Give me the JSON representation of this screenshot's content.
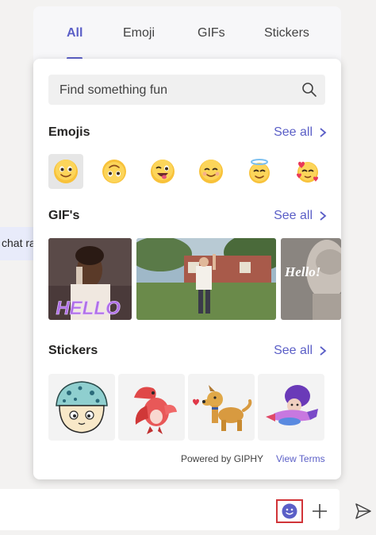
{
  "chat": {
    "snippet": "chat ra"
  },
  "tabs": [
    {
      "label": "All",
      "active": true
    },
    {
      "label": "Emoji",
      "active": false
    },
    {
      "label": "GIFs",
      "active": false
    },
    {
      "label": "Stickers",
      "active": false
    }
  ],
  "search": {
    "placeholder": "Find something fun",
    "icon": "search-icon"
  },
  "sections": {
    "emojis": {
      "title": "Emojis",
      "see_all": "See all"
    },
    "gifs": {
      "title": "GIF's",
      "see_all": "See all"
    },
    "stickers": {
      "title": "Stickers",
      "see_all": "See all"
    }
  },
  "emojis": [
    "smile-emoji",
    "upside-down-emoji",
    "winking-tongue-emoji",
    "blush-emoji",
    "halo-emoji",
    "hearts-emoji"
  ],
  "gifs": [
    {
      "name": "gif-hello-man",
      "caption": "HELLO"
    },
    {
      "name": "gif-wave-boy",
      "caption": ""
    },
    {
      "name": "gif-statue-hello",
      "caption": "Hello!"
    }
  ],
  "stickers": [
    "mushroom-sticker",
    "dragon-sticker",
    "dog-sticker",
    "superhero-sticker"
  ],
  "footer": {
    "powered_by": "Powered by GIPHY",
    "view_terms": "View Terms"
  },
  "colors": {
    "accent": "#5b5fc7",
    "highlight": "#d13438"
  }
}
